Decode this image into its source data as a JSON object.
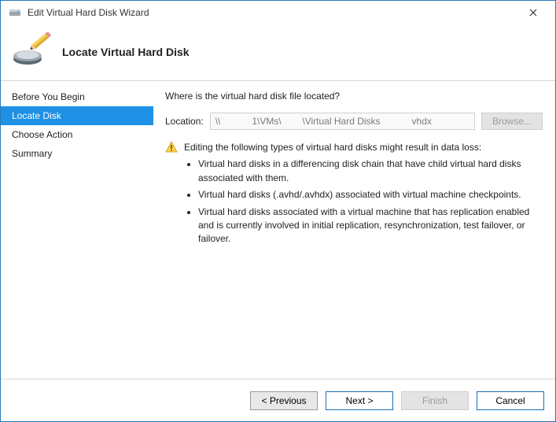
{
  "window": {
    "title": "Edit Virtual Hard Disk Wizard",
    "heading": "Locate Virtual Hard Disk"
  },
  "sidebar": {
    "steps": [
      {
        "label": "Before You Begin",
        "active": false
      },
      {
        "label": "Locate Disk",
        "active": true
      },
      {
        "label": "Choose Action",
        "active": false
      },
      {
        "label": "Summary",
        "active": false
      }
    ]
  },
  "content": {
    "question": "Where is the virtual hard disk file located?",
    "location_label": "Location:",
    "location_value": "\\\\            1\\VMs\\        \\Virtual Hard Disks            vhdx",
    "browse_label": "Browse...",
    "warning_title": "Editing the following types of virtual hard disks might result in data loss:",
    "warning_items": [
      "Virtual hard disks in a differencing disk chain that have child virtual hard disks associated with them.",
      "Virtual hard disks (.avhd/.avhdx) associated with virtual machine checkpoints.",
      "Virtual hard disks associated with a virtual machine that has replication enabled and is currently involved in initial replication, resynchronization, test failover, or failover."
    ]
  },
  "footer": {
    "previous": "< Previous",
    "next": "Next >",
    "finish": "Finish",
    "cancel": "Cancel"
  }
}
